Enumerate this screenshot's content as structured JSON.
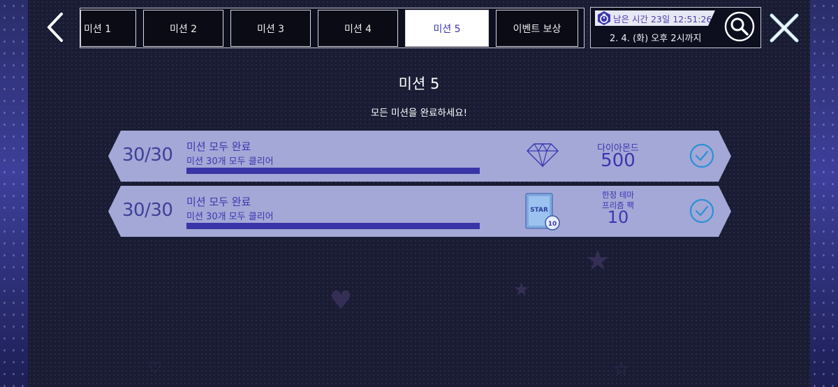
{
  "nav": {
    "back_icon": "chevron-left-icon",
    "search_icon": "search-icon",
    "close_icon": "close-icon"
  },
  "tabs": [
    {
      "label": "미션 1",
      "active": false
    },
    {
      "label": "미션 2",
      "active": false
    },
    {
      "label": "미션 3",
      "active": false
    },
    {
      "label": "미션 4",
      "active": false
    },
    {
      "label": "미션 5",
      "active": true
    },
    {
      "label": "이벤트 보상",
      "active": false
    }
  ],
  "timer": {
    "icon": "stopwatch-icon",
    "remaining": "남은 시간 23일 12:51:26",
    "deadline": "2. 4. (화) 오후 2시까지"
  },
  "page": {
    "title": "미션 5",
    "subtitle": "모든 미션을 완료하세요!"
  },
  "missions": [
    {
      "count": "30/30",
      "name": "미션 모두 완료",
      "desc": "미션 30개 모두 클리어",
      "progress": 1.0,
      "reward_icon": "diamond-icon",
      "reward_label": "다이아몬드",
      "reward_amount": "500",
      "status_icon": "check-circle-icon"
    },
    {
      "count": "30/30",
      "name": "미션 모두 완료",
      "desc": "미션 30개 모두 클리어",
      "progress": 1.0,
      "reward_icon": "prism-pack-icon",
      "reward_label_line1": "한정 테마",
      "reward_label_line2": "프리즘 팩",
      "reward_amount": "10",
      "pack_text": "STAR",
      "pack_badge": "10",
      "status_icon": "check-circle-icon"
    }
  ],
  "colors": {
    "accent": "#3b36b0",
    "row_bg": "#a3a8d6",
    "active_tab": "#ffffff",
    "check": "#2e8fd6"
  }
}
